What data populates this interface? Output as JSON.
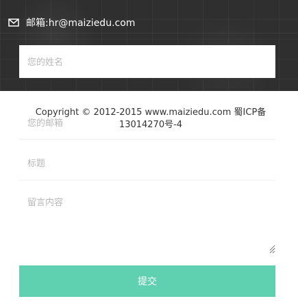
{
  "contact": {
    "icon": "mail-icon",
    "text": "邮箱:hr@maiziedu.com"
  },
  "form": {
    "name_placeholder": "您的姓名",
    "email_placeholder": "您的邮箱",
    "title_placeholder": "标题",
    "message_placeholder": "留言内容",
    "submit_label": "提交"
  },
  "footer": {
    "copyright": "Copyright © 2012-2015 www.maiziedu.com 蜀ICP备13014270号-4"
  },
  "colors": {
    "map_background": "#2f2f2f",
    "submit_button": "#5fd1b0",
    "text": "#333333",
    "placeholder": "#b8b8b8"
  }
}
